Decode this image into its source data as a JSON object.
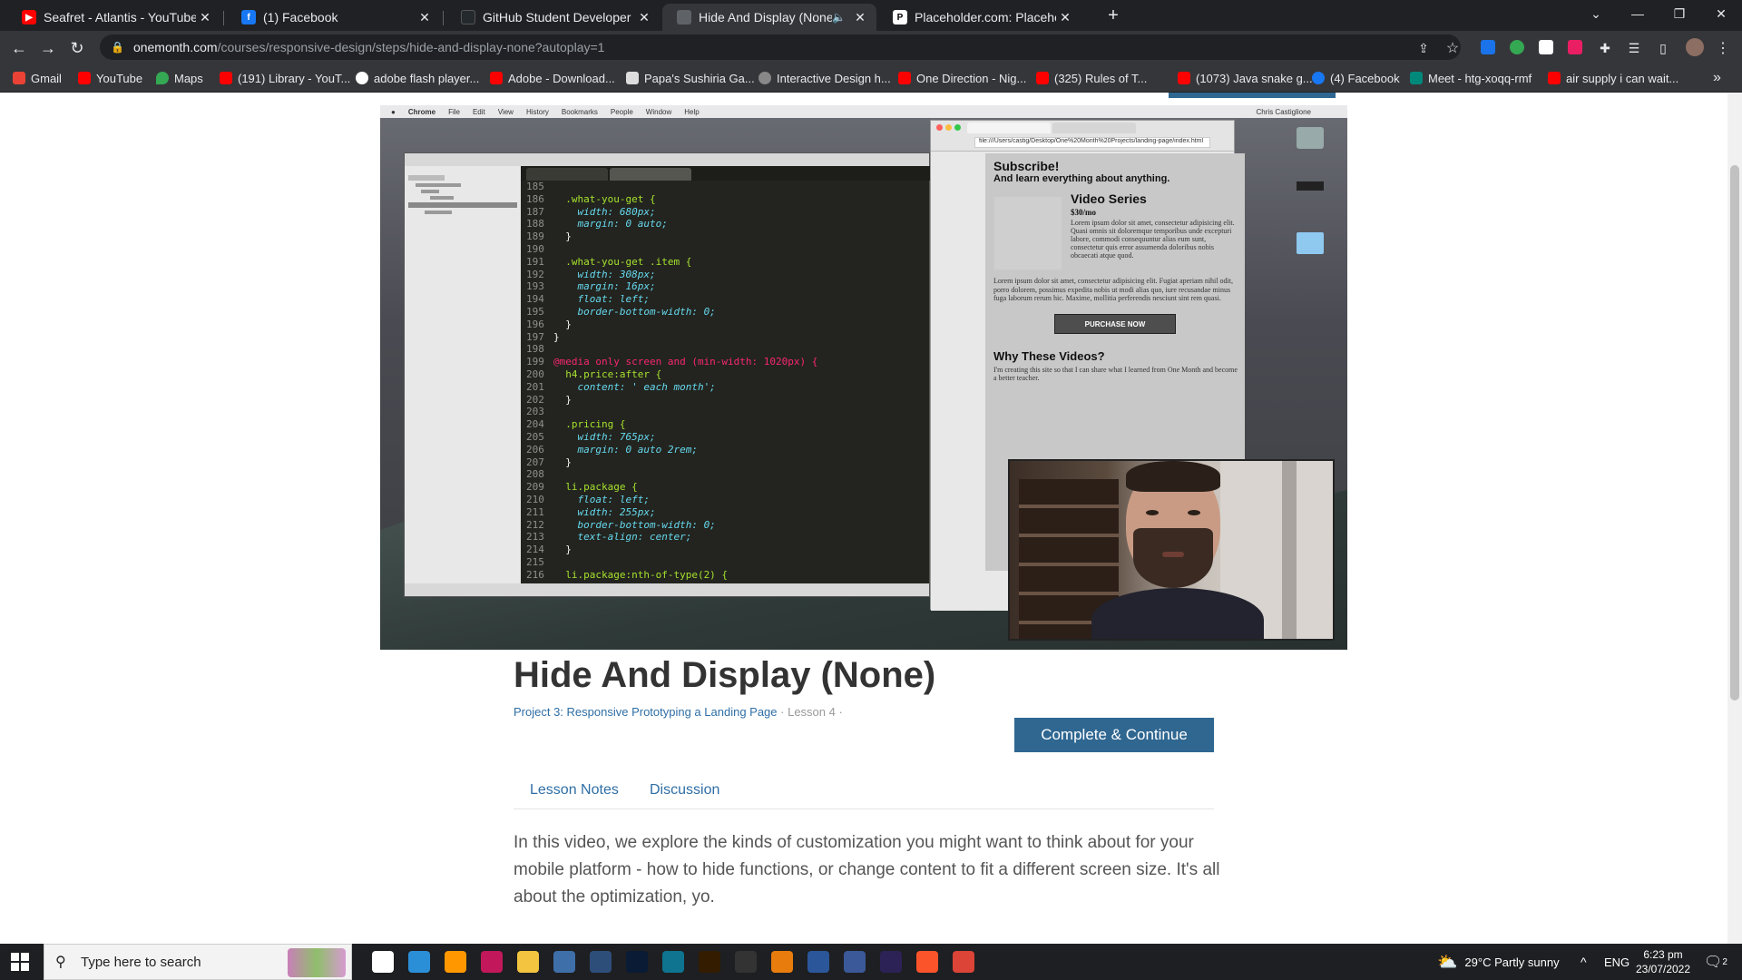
{
  "tabs": [
    {
      "title": "Seafret - Atlantis - YouTube",
      "favicon": "youtube-icon",
      "color": "#ff0000"
    },
    {
      "title": "(1) Facebook",
      "favicon": "facebook-icon",
      "color": "#1877f2"
    },
    {
      "title": "GitHub Student Developer Pack -",
      "favicon": "github-icon",
      "color": "#24292e"
    },
    {
      "title": "Hide And Display (None) | Le",
      "favicon": "page-icon",
      "color": "#5f6368",
      "active": true
    },
    {
      "title": "Placeholder.com: Placeholder.co",
      "favicon": "placeholder-icon",
      "color": "#ffffff"
    }
  ],
  "toolbar": {
    "url_host": "onemonth.com",
    "url_path": "/courses/responsive-design/steps/hide-and-display-none?autoplay=1"
  },
  "bookmarks": [
    {
      "label": "Gmail",
      "color": "#ea4335"
    },
    {
      "label": "YouTube",
      "color": "#ff0000"
    },
    {
      "label": "Maps",
      "color": "#34a853"
    },
    {
      "label": "(191) Library - YouT...",
      "color": "#ff0000"
    },
    {
      "label": "adobe flash player...",
      "color": "#ffffff"
    },
    {
      "label": "Adobe - Download...",
      "color": "#ff0000"
    },
    {
      "label": "Papa's Sushiria Ga...",
      "color": "#dddddd"
    },
    {
      "label": "Interactive Design h...",
      "color": "#888888"
    },
    {
      "label": "One Direction - Nig...",
      "color": "#ff0000"
    },
    {
      "label": "(325) Rules of T...",
      "color": "#ff0000"
    },
    {
      "label": "(1073) Java snake g...",
      "color": "#ff0000"
    },
    {
      "label": "(4) Facebook",
      "color": "#1877f2"
    },
    {
      "label": "Meet - htg-xoqq-rmf",
      "color": "#00897b"
    },
    {
      "label": "air supply i can wait...",
      "color": "#ff0000"
    }
  ],
  "video": {
    "menubar": [
      "Chrome",
      "File",
      "Edit",
      "View",
      "History",
      "Bookmarks",
      "People",
      "Window",
      "Help"
    ],
    "menubar_user": "Chris Castiglione",
    "code_lines": [
      [
        "185",
        ""
      ],
      [
        "186",
        "  .what-you-get {"
      ],
      [
        "187",
        "    width: 680px;"
      ],
      [
        "188",
        "    margin: 0 auto;"
      ],
      [
        "189",
        "  }"
      ],
      [
        "190",
        ""
      ],
      [
        "191",
        "  .what-you-get .item {"
      ],
      [
        "192",
        "    width: 308px;"
      ],
      [
        "193",
        "    margin: 16px;"
      ],
      [
        "194",
        "    float: left;"
      ],
      [
        "195",
        "    border-bottom-width: 0;"
      ],
      [
        "196",
        "  }"
      ],
      [
        "197",
        "}"
      ],
      [
        "198",
        ""
      ],
      [
        "199",
        "@media only screen and (min-width: 1020px) {"
      ],
      [
        "200",
        "  h4.price:after {"
      ],
      [
        "201",
        "    content: ' each month';"
      ],
      [
        "202",
        "  }"
      ],
      [
        "203",
        ""
      ],
      [
        "204",
        "  .pricing {"
      ],
      [
        "205",
        "    width: 765px;"
      ],
      [
        "206",
        "    margin: 0 auto 2rem;"
      ],
      [
        "207",
        "  }"
      ],
      [
        "208",
        ""
      ],
      [
        "209",
        "  li.package {"
      ],
      [
        "210",
        "    float: left;"
      ],
      [
        "211",
        "    width: 255px;"
      ],
      [
        "212",
        "    border-bottom-width: 0;"
      ],
      [
        "213",
        "    text-align: center;"
      ],
      [
        "214",
        "  }"
      ],
      [
        "215",
        ""
      ],
      [
        "216",
        "  li.package:nth-of-type(2) {"
      ]
    ],
    "browser_url": "file:///Users/castig/Desktop/One%20Month%20Projects/landing-page/index.html",
    "mock": {
      "subscribe": "Subscribe!",
      "learn": "And learn everything about anything.",
      "series": "Video Series",
      "price": "$30/mo",
      "lorem1": "Lorem ipsum dolor sit amet, consectetur adipisicing elit. Quasi omnis sit doloremque temporibus unde excepturi labore, commodi consequuntur alias eum sunt, consectetur quis error assumenda doloribus nobis obcaecati atque quod.",
      "lorem2": "Lorem ipsum dolor sit amet, consectetur adipisicing elit. Fugiat aperiam nihil odit, porro dolorem, possimus expedita nobis ut modi alias quo, iure recusandae minus fuga laborum rerum hic. Maxime, mollitia perferendis nesciunt sint rem quasi.",
      "buy": "PURCHASE NOW",
      "why": "Why These Videos?",
      "why_text": "I'm creating this site so that I can share what I learned from One Month and become a better teacher."
    }
  },
  "lesson": {
    "title": "Hide And Display (None)",
    "project_link": "Project 3: Responsive Prototyping a Landing Page",
    "lesson_num": "· Lesson 4 ·",
    "complete_label": "Complete & Continue",
    "tabs": [
      "Lesson Notes",
      "Discussion"
    ],
    "description": "In this video, we explore the kinds of customization you might want to think about for your mobile platform - how to hide functions, or change content to fit a different screen size. It's all about the optimization, yo."
  },
  "taskbar": {
    "search_placeholder": "Type here to search",
    "weather": "29°C  Partly sunny",
    "lang": "ENG",
    "time": "6:23 pm",
    "date": "23/07/2022",
    "notif_count": "2",
    "apps": [
      {
        "name": "task-view-icon",
        "color": "#ffffff"
      },
      {
        "name": "vscode-icon",
        "color": "#2b8fd8"
      },
      {
        "name": "sublime-icon",
        "color": "#ff9800"
      },
      {
        "name": "app-icon",
        "color": "#c2185b"
      },
      {
        "name": "file-explorer-icon",
        "color": "#f3c43f"
      },
      {
        "name": "app-icon-2",
        "color": "#3f6fa8"
      },
      {
        "name": "app-icon-3",
        "color": "#2e4e7a"
      },
      {
        "name": "photoshop-icon",
        "color": "#0a1b36"
      },
      {
        "name": "app-icon-4",
        "color": "#0e7490"
      },
      {
        "name": "illustrator-icon",
        "color": "#331c00"
      },
      {
        "name": "unity-icon",
        "color": "#333333"
      },
      {
        "name": "blender-icon",
        "color": "#e87d0d"
      },
      {
        "name": "word-icon",
        "color": "#2b579a"
      },
      {
        "name": "app-icon-5",
        "color": "#3b5998"
      },
      {
        "name": "eclipse-icon",
        "color": "#2c2255"
      },
      {
        "name": "brave-icon",
        "color": "#fb542b"
      },
      {
        "name": "chrome-icon",
        "color": "#db4437"
      }
    ]
  }
}
